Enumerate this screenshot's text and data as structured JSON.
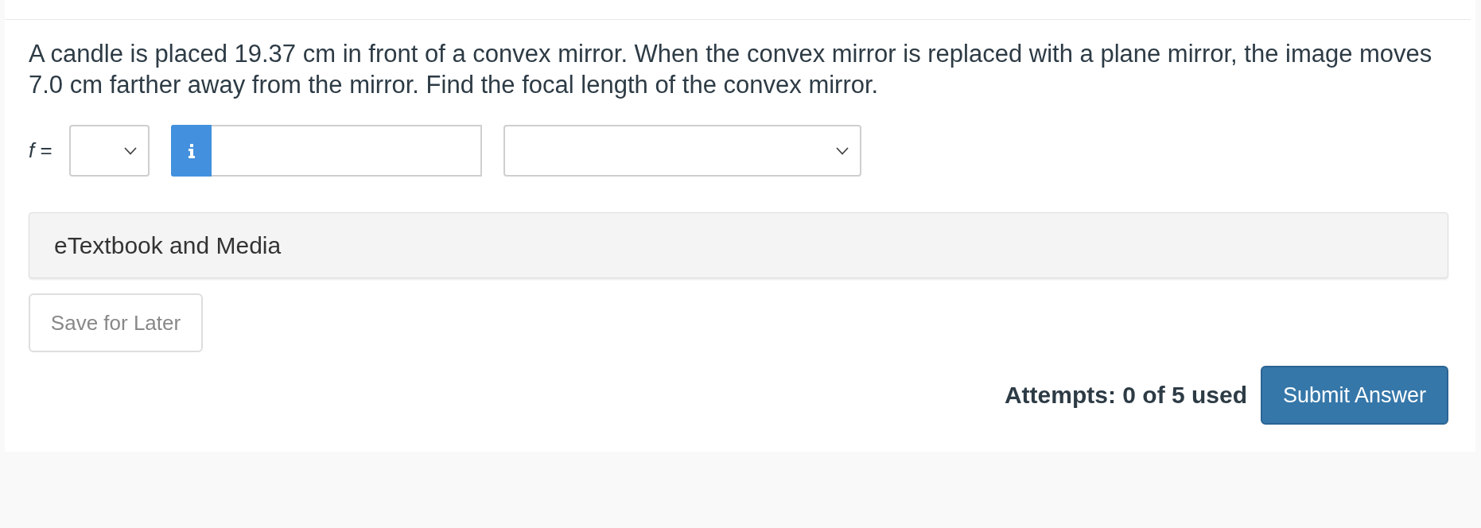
{
  "question": {
    "text": "A candle is placed 19.37 cm in front of a convex mirror. When the convex mirror is replaced with a plane mirror, the image moves 7.0 cm farther away from the mirror. Find the focal length of the convex mirror."
  },
  "answer_row": {
    "label": "*f* =",
    "controls": [
      {
        "kind": "select_small"
      },
      {
        "kind": "info_input"
      },
      {
        "kind": "select_large"
      }
    ]
  },
  "resources": {
    "label": "eTextbook and Media"
  },
  "save_button": {
    "label": "Save for Later"
  },
  "attempts": {
    "text": "Attempts: 0 of 5 used"
  },
  "submit_button": {
    "label": "Submit Answer"
  }
}
